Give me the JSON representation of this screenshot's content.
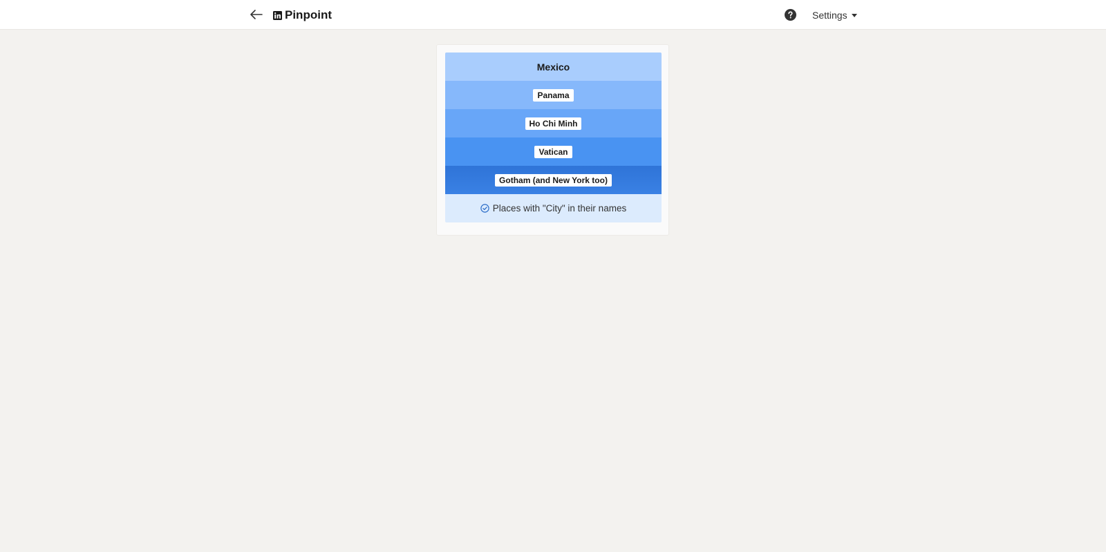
{
  "header": {
    "brand_name": "Pinpoint",
    "settings_label": "Settings",
    "back_icon": "arrow-left-icon",
    "logo_icon": "linkedin-logo-icon",
    "help_icon": "question-circle-icon"
  },
  "puzzle": {
    "clues": [
      "Mexico",
      "Panama",
      "Ho Chi Minh",
      "Vatican",
      "Gotham (and New York too)"
    ],
    "answer": "Places with \"City\" in their names",
    "answer_icon": "check-circle-icon",
    "colors": {
      "row_1": "#a9cdfd",
      "row_2": "#86b8fb",
      "row_3": "#68a6f8",
      "row_4": "#4993f2",
      "row_5": "#3278dc",
      "answer_bg": "#dcebfd",
      "check": "#2e6fc9"
    }
  }
}
